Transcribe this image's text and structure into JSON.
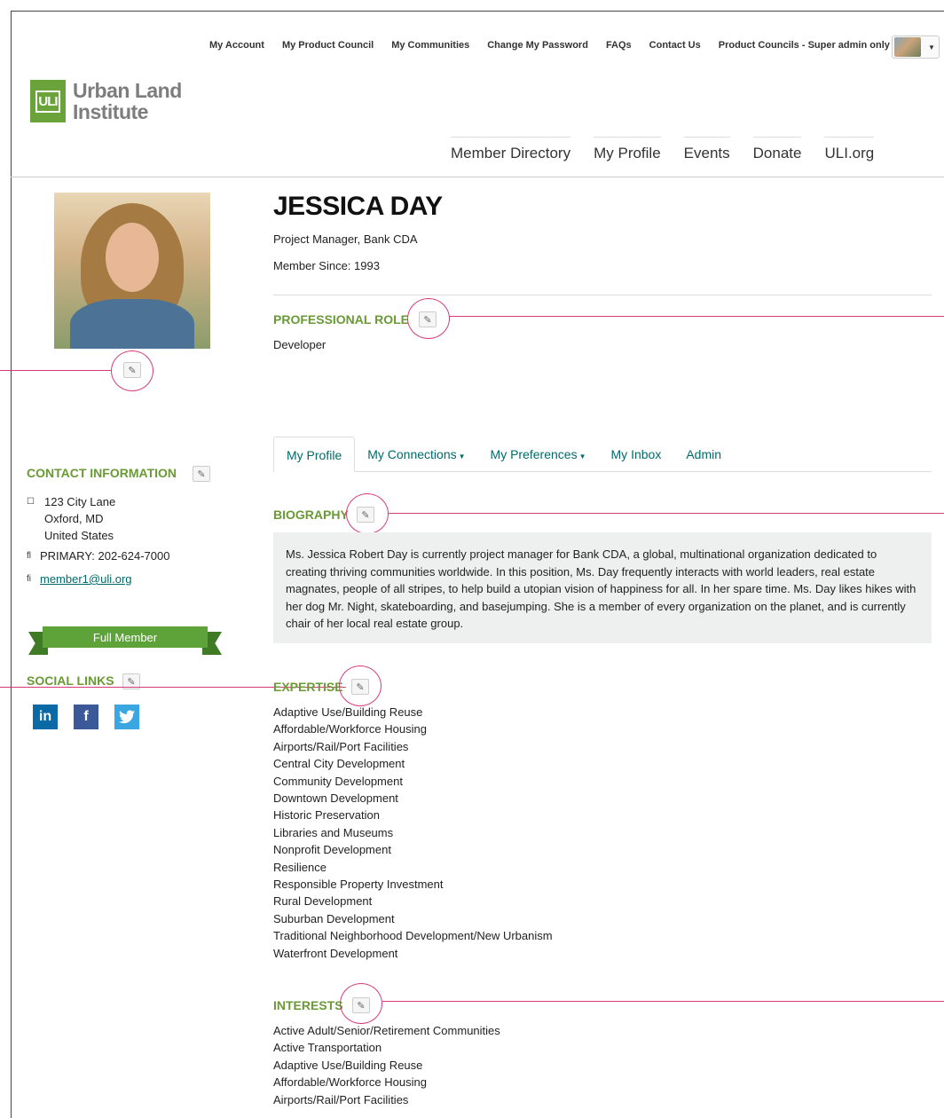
{
  "utility_nav": [
    "My Account",
    "My Product Council",
    "My Communities",
    "Change My Password",
    "FAQs",
    "Contact Us",
    "Product Councils - Super admin only"
  ],
  "logo": {
    "mark": "ULI",
    "line1": "Urban Land",
    "line2": "Institute"
  },
  "main_nav": [
    "Member Directory",
    "My Profile",
    "Events",
    "Donate",
    "ULI.org"
  ],
  "profile": {
    "name": "JESSICA DAY",
    "title": "Project Manager, Bank CDA",
    "member_since": "Member Since: 1993"
  },
  "professional_role": {
    "heading": "PROFESSIONAL ROLE",
    "value": "Developer"
  },
  "contact": {
    "heading": "CONTACT INFORMATION",
    "address_line1": "123 City Lane",
    "address_line2": "Oxford, MD",
    "address_line3": "United States",
    "phone": "PRIMARY: 202-624-7000",
    "email": "member1@uli.org"
  },
  "membership_badge": "Full Member",
  "social": {
    "heading": "SOCIAL LINKS",
    "linkedin": "in",
    "facebook": "f"
  },
  "tabs": [
    "My Profile",
    "My Connections",
    "My Preferences",
    "My Inbox",
    "Admin"
  ],
  "biography": {
    "heading": "BIOGRAPHY",
    "text": "Ms. Jessica Robert Day is currently project manager for Bank CDA, a global, multinational organization dedicated to creating thriving communities worldwide. In this position, Ms. Day frequently interacts with world leaders, real estate magnates, people of all stripes, to help build a utopian vision of happiness for all. In her spare time. Ms. Day likes hikes with her dog Mr. Night, skateboarding, and basejumping. She is a member of every organization on the planet, and is currently chair of her local real estate group."
  },
  "expertise": {
    "heading": "EXPERTISE",
    "items": [
      "Adaptive Use/Building Reuse",
      "Affordable/Workforce Housing",
      "Airports/Rail/Port Facilities",
      "Central City Development",
      "Community Development",
      "Downtown Development",
      "Historic Preservation",
      "Libraries and Museums",
      "Nonprofit Development",
      "Resilience",
      "Responsible Property Investment",
      "Rural Development",
      "Suburban Development",
      "Traditional Neighborhood Development/New Urbanism",
      "Waterfront Development"
    ]
  },
  "interests": {
    "heading": "INTERESTS",
    "items": [
      "Active Adult/Senior/Retirement Communities",
      "Active Transportation",
      "Adaptive Use/Building Reuse",
      "Affordable/Workforce Housing",
      "Airports/Rail/Port Facilities"
    ]
  },
  "colors": {
    "accent_green": "#6a9a35",
    "link_teal": "#006a6a",
    "annotation_pink": "#d63b7a"
  }
}
